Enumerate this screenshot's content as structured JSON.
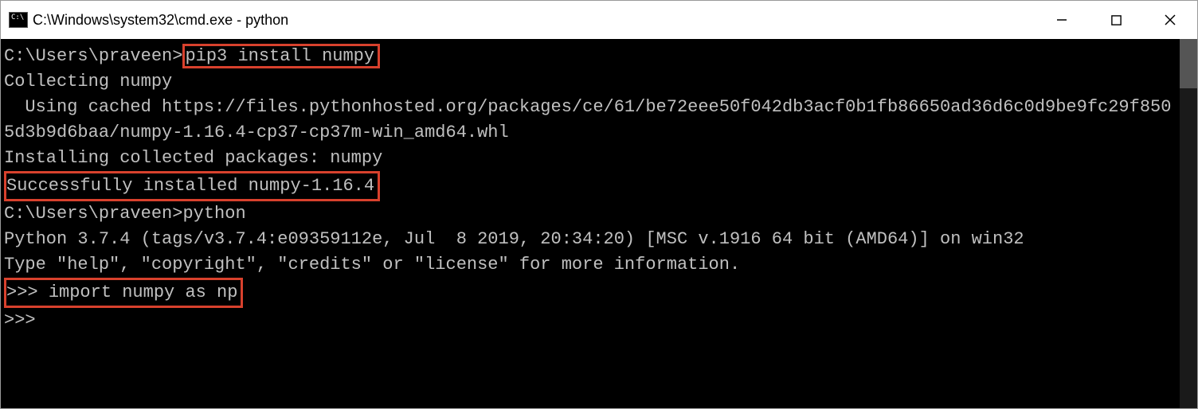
{
  "window": {
    "title": "C:\\Windows\\system32\\cmd.exe - python",
    "icon_label": "C:\\"
  },
  "terminal": {
    "prompt1": "C:\\Users\\praveen>",
    "cmd1": "pip3 install numpy",
    "line_collecting": "Collecting numpy",
    "line_cached": "  Using cached https://files.pythonhosted.org/packages/ce/61/be72eee50f042db3acf0b1fb86650ad36d6c0d9be9fc29f8505d3b9d6baa/numpy-1.16.4-cp37-cp37m-win_amd64.whl",
    "line_installing": "Installing collected packages: numpy",
    "line_success": "Successfully installed numpy-1.16.4",
    "blank": "",
    "prompt2": "C:\\Users\\praveen>",
    "cmd2": "python",
    "line_pyver": "Python 3.7.4 (tags/v3.7.4:e09359112e, Jul  8 2019, 20:34:20) [MSC v.1916 64 bit (AMD64)] on win32",
    "line_help": "Type \"help\", \"copyright\", \"credits\" or \"license\" for more information.",
    "py_prompt1": ">>> ",
    "py_stmt1": "import numpy as np",
    "py_prompt2": ">>>"
  },
  "highlight_color": "#d8412d"
}
